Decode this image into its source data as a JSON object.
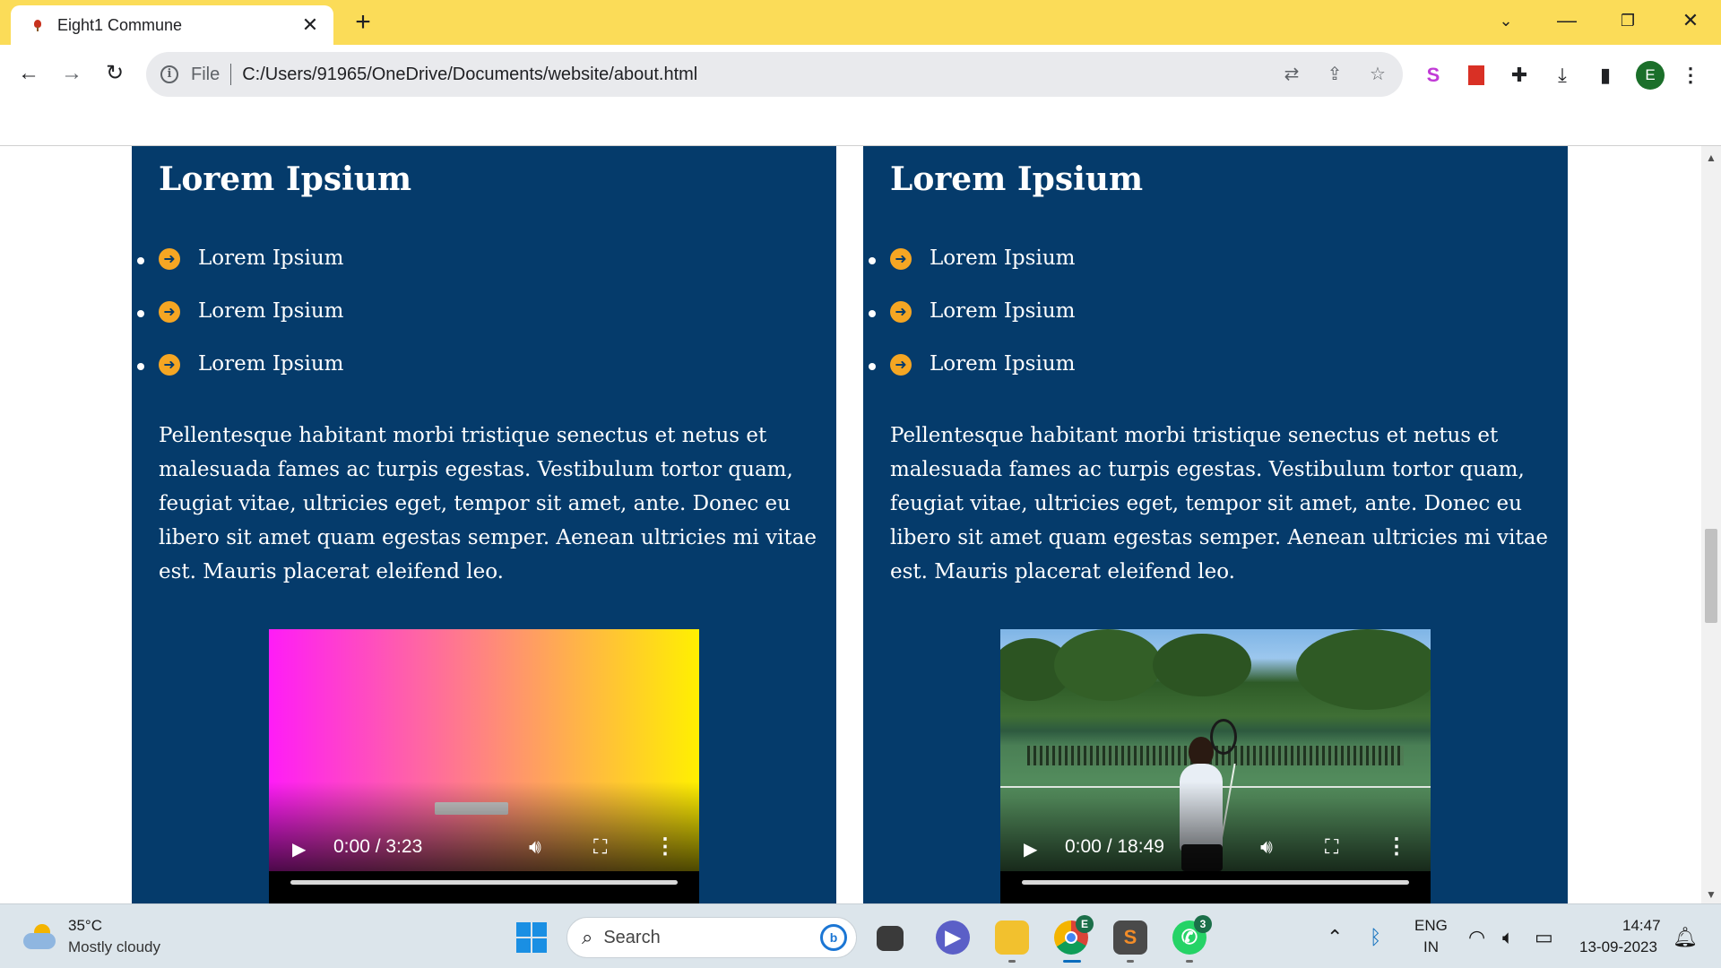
{
  "browser": {
    "tab_title": "Eight1 Commune",
    "tab_close": "✕",
    "new_tab": "+",
    "omnibox_scheme": "File",
    "url": "C:/Users/91965/OneDrive/Documents/website/about.html",
    "profile_initial": "E",
    "accent_color": "#fbdc58"
  },
  "cards": [
    {
      "title": "Lorem Ipsium",
      "items": [
        "Lorem Ipsium",
        "Lorem Ipsium",
        "Lorem Ipsium"
      ],
      "paragraph": "Pellentesque habitant morbi tristique senectus et netus et malesuada fames ac turpis egestas. Vestibulum tortor quam, feugiat vitae, ultricies eget, tempor sit amet, ante. Donec eu libero sit amet quam egestas semper. Aenean ultricies mi vitae est. Mauris placerat eleifend leo.",
      "video_time": "0:00 / 3:23"
    },
    {
      "title": "Lorem Ipsium",
      "items": [
        "Lorem Ipsium",
        "Lorem Ipsium",
        "Lorem Ipsium"
      ],
      "paragraph": "Pellentesque habitant morbi tristique senectus et netus et malesuada fames ac turpis egestas. Vestibulum tortor quam, feugiat vitae, ultricies eget, tempor sit amet, ante. Donec eu libero sit amet quam egestas semper. Aenean ultricies mi vitae est. Mauris placerat eleifend leo.",
      "video_time": "0:00 / 18:49"
    }
  ],
  "colors": {
    "card_bg": "#053b6b",
    "arrow_accent": "#f5a623"
  },
  "taskbar": {
    "temperature": "35°C",
    "weather": "Mostly cloudy",
    "search_label": "Search",
    "language": "ENG",
    "region": "IN",
    "time": "14:47",
    "date": "13-09-2023",
    "chrome_badge": "E",
    "whatsapp_badge": "3"
  }
}
